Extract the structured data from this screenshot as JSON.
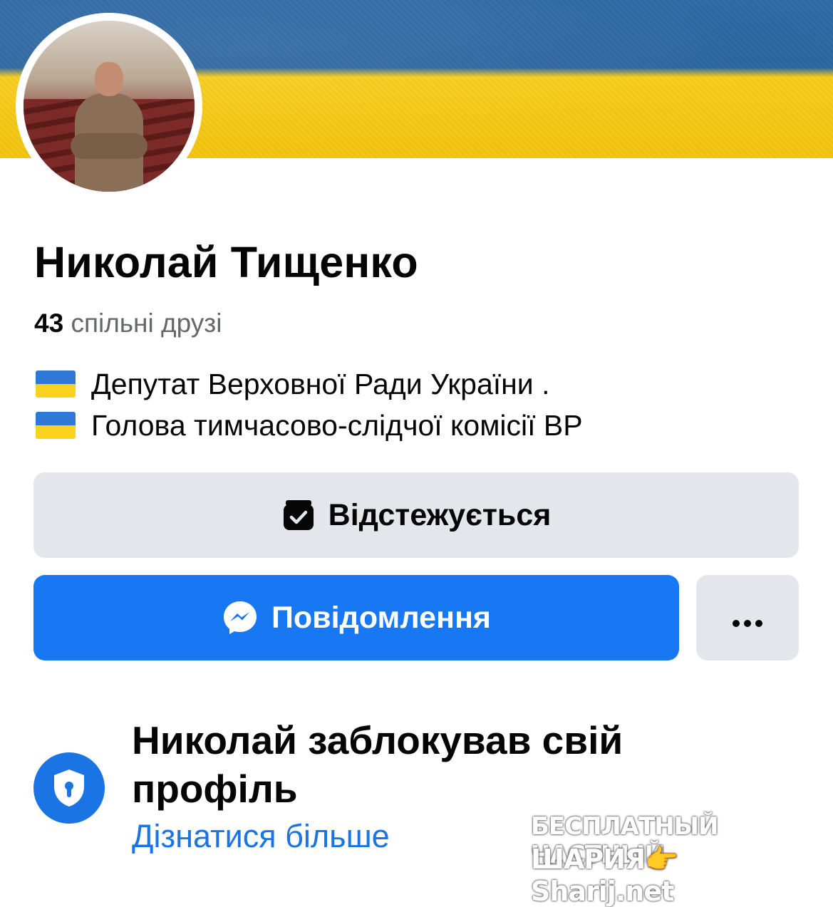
{
  "profile": {
    "name": "Николай Тищенко",
    "mutual_count": "43",
    "mutual_label": "спільні друзі",
    "bio": [
      {
        "icon": "ukraine-flag-emoji",
        "text": "Депутат Верховної Ради України ."
      },
      {
        "icon": "ukraine-flag-emoji",
        "text": "Голова тимчасово-слідчої комісії ВР"
      }
    ]
  },
  "actions": {
    "following_label": "Відстежується",
    "following_icon": "following-check-icon",
    "message_label": "Повідомлення",
    "message_icon": "messenger-icon",
    "more_icon": "more-dots-icon"
  },
  "locked": {
    "title": "Николай заблокував свій профіль",
    "link": "Дізнатися більше",
    "icon": "shield-lock-icon"
  },
  "watermark": {
    "line1": "БЕСПЛАТНЫЙ ЧАСТНЫЙ",
    "line2": "ШАРИЯ👉Sharij.net"
  },
  "colors": {
    "accent_blue": "#1877f2",
    "link_blue": "#1b74e4",
    "secondary_button": "#e4e6eb",
    "flag_blue": "#2f6aa5",
    "flag_yellow": "#f5c914"
  }
}
